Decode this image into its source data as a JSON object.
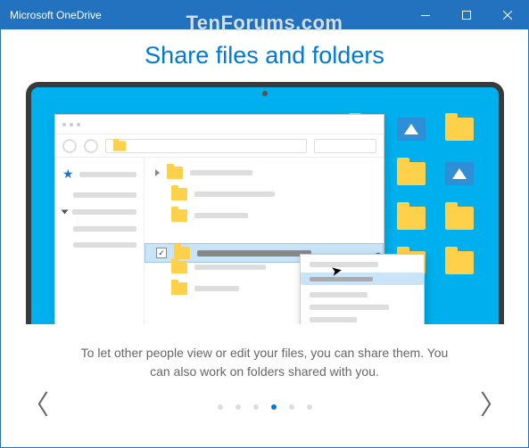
{
  "titlebar": {
    "title": "Microsoft OneDrive"
  },
  "watermark": "TenForums.com",
  "page": {
    "title": "Share files and folders",
    "description": "To let other people view or edit your files, you can share them. You can also work on folders shared with you."
  },
  "pager": {
    "count": 6,
    "active_index": 3
  }
}
